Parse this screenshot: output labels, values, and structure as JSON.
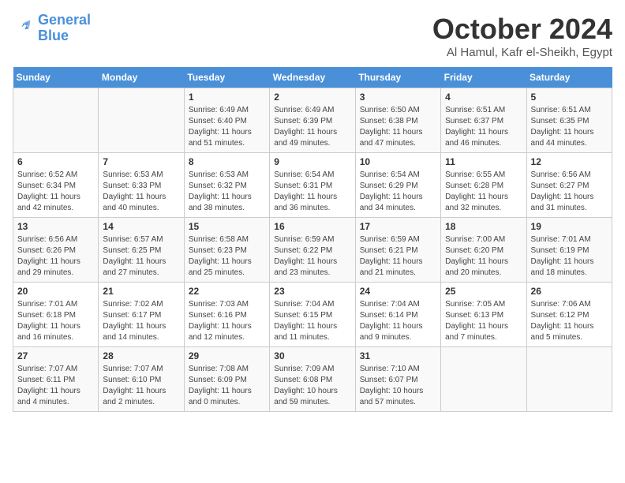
{
  "header": {
    "logo_line1": "General",
    "logo_line2": "Blue",
    "month": "October 2024",
    "location": "Al Hamul, Kafr el-Sheikh, Egypt"
  },
  "weekdays": [
    "Sunday",
    "Monday",
    "Tuesday",
    "Wednesday",
    "Thursday",
    "Friday",
    "Saturday"
  ],
  "weeks": [
    [
      {
        "num": "",
        "sunrise": "",
        "sunset": "",
        "daylight": ""
      },
      {
        "num": "",
        "sunrise": "",
        "sunset": "",
        "daylight": ""
      },
      {
        "num": "1",
        "sunrise": "Sunrise: 6:49 AM",
        "sunset": "Sunset: 6:40 PM",
        "daylight": "Daylight: 11 hours and 51 minutes."
      },
      {
        "num": "2",
        "sunrise": "Sunrise: 6:49 AM",
        "sunset": "Sunset: 6:39 PM",
        "daylight": "Daylight: 11 hours and 49 minutes."
      },
      {
        "num": "3",
        "sunrise": "Sunrise: 6:50 AM",
        "sunset": "Sunset: 6:38 PM",
        "daylight": "Daylight: 11 hours and 47 minutes."
      },
      {
        "num": "4",
        "sunrise": "Sunrise: 6:51 AM",
        "sunset": "Sunset: 6:37 PM",
        "daylight": "Daylight: 11 hours and 46 minutes."
      },
      {
        "num": "5",
        "sunrise": "Sunrise: 6:51 AM",
        "sunset": "Sunset: 6:35 PM",
        "daylight": "Daylight: 11 hours and 44 minutes."
      }
    ],
    [
      {
        "num": "6",
        "sunrise": "Sunrise: 6:52 AM",
        "sunset": "Sunset: 6:34 PM",
        "daylight": "Daylight: 11 hours and 42 minutes."
      },
      {
        "num": "7",
        "sunrise": "Sunrise: 6:53 AM",
        "sunset": "Sunset: 6:33 PM",
        "daylight": "Daylight: 11 hours and 40 minutes."
      },
      {
        "num": "8",
        "sunrise": "Sunrise: 6:53 AM",
        "sunset": "Sunset: 6:32 PM",
        "daylight": "Daylight: 11 hours and 38 minutes."
      },
      {
        "num": "9",
        "sunrise": "Sunrise: 6:54 AM",
        "sunset": "Sunset: 6:31 PM",
        "daylight": "Daylight: 11 hours and 36 minutes."
      },
      {
        "num": "10",
        "sunrise": "Sunrise: 6:54 AM",
        "sunset": "Sunset: 6:29 PM",
        "daylight": "Daylight: 11 hours and 34 minutes."
      },
      {
        "num": "11",
        "sunrise": "Sunrise: 6:55 AM",
        "sunset": "Sunset: 6:28 PM",
        "daylight": "Daylight: 11 hours and 32 minutes."
      },
      {
        "num": "12",
        "sunrise": "Sunrise: 6:56 AM",
        "sunset": "Sunset: 6:27 PM",
        "daylight": "Daylight: 11 hours and 31 minutes."
      }
    ],
    [
      {
        "num": "13",
        "sunrise": "Sunrise: 6:56 AM",
        "sunset": "Sunset: 6:26 PM",
        "daylight": "Daylight: 11 hours and 29 minutes."
      },
      {
        "num": "14",
        "sunrise": "Sunrise: 6:57 AM",
        "sunset": "Sunset: 6:25 PM",
        "daylight": "Daylight: 11 hours and 27 minutes."
      },
      {
        "num": "15",
        "sunrise": "Sunrise: 6:58 AM",
        "sunset": "Sunset: 6:23 PM",
        "daylight": "Daylight: 11 hours and 25 minutes."
      },
      {
        "num": "16",
        "sunrise": "Sunrise: 6:59 AM",
        "sunset": "Sunset: 6:22 PM",
        "daylight": "Daylight: 11 hours and 23 minutes."
      },
      {
        "num": "17",
        "sunrise": "Sunrise: 6:59 AM",
        "sunset": "Sunset: 6:21 PM",
        "daylight": "Daylight: 11 hours and 21 minutes."
      },
      {
        "num": "18",
        "sunrise": "Sunrise: 7:00 AM",
        "sunset": "Sunset: 6:20 PM",
        "daylight": "Daylight: 11 hours and 20 minutes."
      },
      {
        "num": "19",
        "sunrise": "Sunrise: 7:01 AM",
        "sunset": "Sunset: 6:19 PM",
        "daylight": "Daylight: 11 hours and 18 minutes."
      }
    ],
    [
      {
        "num": "20",
        "sunrise": "Sunrise: 7:01 AM",
        "sunset": "Sunset: 6:18 PM",
        "daylight": "Daylight: 11 hours and 16 minutes."
      },
      {
        "num": "21",
        "sunrise": "Sunrise: 7:02 AM",
        "sunset": "Sunset: 6:17 PM",
        "daylight": "Daylight: 11 hours and 14 minutes."
      },
      {
        "num": "22",
        "sunrise": "Sunrise: 7:03 AM",
        "sunset": "Sunset: 6:16 PM",
        "daylight": "Daylight: 11 hours and 12 minutes."
      },
      {
        "num": "23",
        "sunrise": "Sunrise: 7:04 AM",
        "sunset": "Sunset: 6:15 PM",
        "daylight": "Daylight: 11 hours and 11 minutes."
      },
      {
        "num": "24",
        "sunrise": "Sunrise: 7:04 AM",
        "sunset": "Sunset: 6:14 PM",
        "daylight": "Daylight: 11 hours and 9 minutes."
      },
      {
        "num": "25",
        "sunrise": "Sunrise: 7:05 AM",
        "sunset": "Sunset: 6:13 PM",
        "daylight": "Daylight: 11 hours and 7 minutes."
      },
      {
        "num": "26",
        "sunrise": "Sunrise: 7:06 AM",
        "sunset": "Sunset: 6:12 PM",
        "daylight": "Daylight: 11 hours and 5 minutes."
      }
    ],
    [
      {
        "num": "27",
        "sunrise": "Sunrise: 7:07 AM",
        "sunset": "Sunset: 6:11 PM",
        "daylight": "Daylight: 11 hours and 4 minutes."
      },
      {
        "num": "28",
        "sunrise": "Sunrise: 7:07 AM",
        "sunset": "Sunset: 6:10 PM",
        "daylight": "Daylight: 11 hours and 2 minutes."
      },
      {
        "num": "29",
        "sunrise": "Sunrise: 7:08 AM",
        "sunset": "Sunset: 6:09 PM",
        "daylight": "Daylight: 11 hours and 0 minutes."
      },
      {
        "num": "30",
        "sunrise": "Sunrise: 7:09 AM",
        "sunset": "Sunset: 6:08 PM",
        "daylight": "Daylight: 10 hours and 59 minutes."
      },
      {
        "num": "31",
        "sunrise": "Sunrise: 7:10 AM",
        "sunset": "Sunset: 6:07 PM",
        "daylight": "Daylight: 10 hours and 57 minutes."
      },
      {
        "num": "",
        "sunrise": "",
        "sunset": "",
        "daylight": ""
      },
      {
        "num": "",
        "sunrise": "",
        "sunset": "",
        "daylight": ""
      }
    ]
  ]
}
